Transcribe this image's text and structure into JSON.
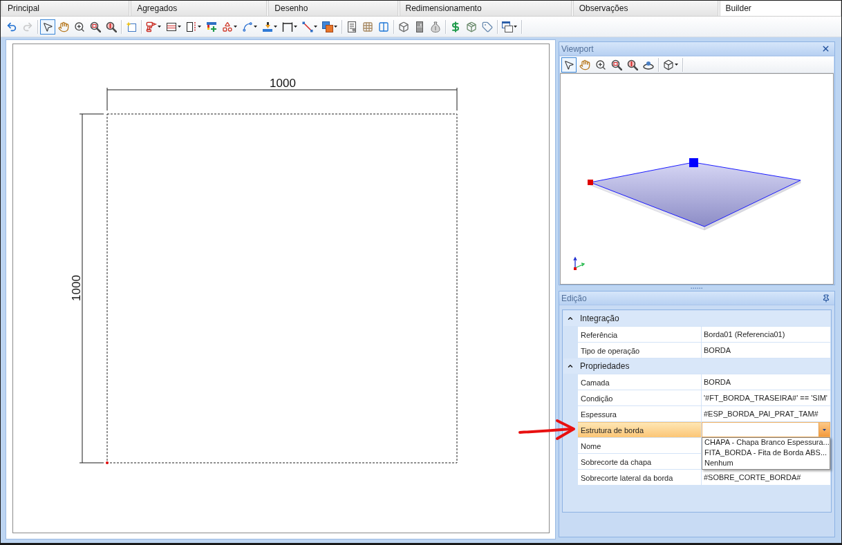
{
  "tabs": [
    {
      "label": "Principal",
      "selected": false
    },
    {
      "label": "Agregados",
      "selected": false
    },
    {
      "label": "Desenho",
      "selected": false
    },
    {
      "label": "Redimensionamento",
      "selected": false
    },
    {
      "label": "Observações",
      "selected": false
    },
    {
      "label": "Builder",
      "selected": true
    }
  ],
  "toolbar": {
    "items": [
      {
        "kind": "button",
        "selected": false,
        "disabled": false
      },
      {
        "kind": "button",
        "selected": false,
        "disabled": true
      },
      {
        "kind": "separator"
      },
      {
        "kind": "button",
        "selected": true,
        "disabled": false
      },
      {
        "kind": "button",
        "selected": false,
        "disabled": false
      },
      {
        "kind": "button",
        "selected": false,
        "disabled": false
      },
      {
        "kind": "button",
        "selected": false,
        "disabled": false
      },
      {
        "kind": "button",
        "selected": false,
        "disabled": false
      },
      {
        "kind": "separator"
      },
      {
        "kind": "button",
        "selected": false,
        "disabled": false
      },
      {
        "kind": "separator"
      },
      {
        "kind": "dropdown",
        "selected": false,
        "disabled": false
      },
      {
        "kind": "dropdown",
        "selected": false,
        "disabled": false
      },
      {
        "kind": "dropdown",
        "selected": false,
        "disabled": false
      },
      {
        "kind": "button",
        "selected": false,
        "disabled": false
      },
      {
        "kind": "dropdown",
        "selected": false,
        "disabled": false
      },
      {
        "kind": "dropdown",
        "selected": false,
        "disabled": false
      },
      {
        "kind": "dropdown",
        "selected": false,
        "disabled": false
      },
      {
        "kind": "dropdown",
        "selected": false,
        "disabled": false
      },
      {
        "kind": "dropdown",
        "selected": false,
        "disabled": false
      },
      {
        "kind": "dropdown",
        "selected": false,
        "disabled": false
      },
      {
        "kind": "separator"
      },
      {
        "kind": "button",
        "selected": false,
        "disabled": false
      },
      {
        "kind": "button",
        "selected": false,
        "disabled": false
      },
      {
        "kind": "button",
        "selected": false,
        "disabled": false
      },
      {
        "kind": "separator"
      },
      {
        "kind": "button",
        "selected": false,
        "disabled": false
      },
      {
        "kind": "button",
        "selected": false,
        "disabled": false
      },
      {
        "kind": "button",
        "selected": false,
        "disabled": false
      },
      {
        "kind": "separator"
      },
      {
        "kind": "button",
        "selected": false,
        "disabled": false
      },
      {
        "kind": "button",
        "selected": false,
        "disabled": false
      },
      {
        "kind": "button",
        "selected": false,
        "disabled": false
      },
      {
        "kind": "separator"
      },
      {
        "kind": "dropdown",
        "selected": false,
        "disabled": false
      },
      {
        "kind": "separator"
      }
    ]
  },
  "canvas": {
    "horizontal_dimension": {
      "label": "1000"
    },
    "vertical_dimension": {
      "label": "1000"
    }
  },
  "viewport": {
    "title": "Viewport",
    "toolbar": {
      "items": [
        {
          "kind": "button",
          "selected": true,
          "disabled": false
        },
        {
          "kind": "button",
          "selected": false,
          "disabled": false
        },
        {
          "kind": "button",
          "selected": false,
          "disabled": false
        },
        {
          "kind": "button",
          "selected": false,
          "disabled": false
        },
        {
          "kind": "button",
          "selected": false,
          "disabled": false
        },
        {
          "kind": "button",
          "selected": false,
          "disabled": false
        },
        {
          "kind": "separator"
        },
        {
          "kind": "dropdown",
          "selected": false,
          "disabled": false
        },
        {
          "kind": "separator"
        }
      ]
    }
  },
  "edit_panel": {
    "title": "Edição",
    "categories": [
      {
        "label": "Integração",
        "expanded": true,
        "properties": [
          {
            "label": "Referência",
            "value": "Borda01 (Referencia01)",
            "selected": false
          },
          {
            "label": "Tipo de operação",
            "value": "BORDA",
            "selected": false
          }
        ]
      },
      {
        "label": "Propriedades",
        "expanded": true,
        "properties": [
          {
            "label": "Camada",
            "value": "BORDA",
            "selected": false
          },
          {
            "label": "Condição",
            "value": "'#FT_BORDA_TRASEIRA#' == 'SIM'",
            "selected": false
          },
          {
            "label": "Espessura",
            "value": "#ESP_BORDA_PAI_PRAT_TAM#",
            "selected": false
          },
          {
            "label": "Estrutura de borda",
            "selected": true,
            "editor": {
              "kind": "combobox",
              "open": true,
              "options": [
                {
                  "label": "CHAPA - Chapa Branco Espessura...",
                  "selected": false
                },
                {
                  "label": "FITA_BORDA - Fita de Borda ABS...",
                  "selected": false
                },
                {
                  "label": "Nenhum",
                  "selected": false
                }
              ]
            }
          },
          {
            "label": "Nome",
            "selected": false
          },
          {
            "label": "Sobrecorte da chapa",
            "selected": false
          },
          {
            "label": "Sobrecorte lateral da borda",
            "value": "#SOBRE_CORTE_BORDA#",
            "selected": false
          }
        ]
      }
    ]
  }
}
